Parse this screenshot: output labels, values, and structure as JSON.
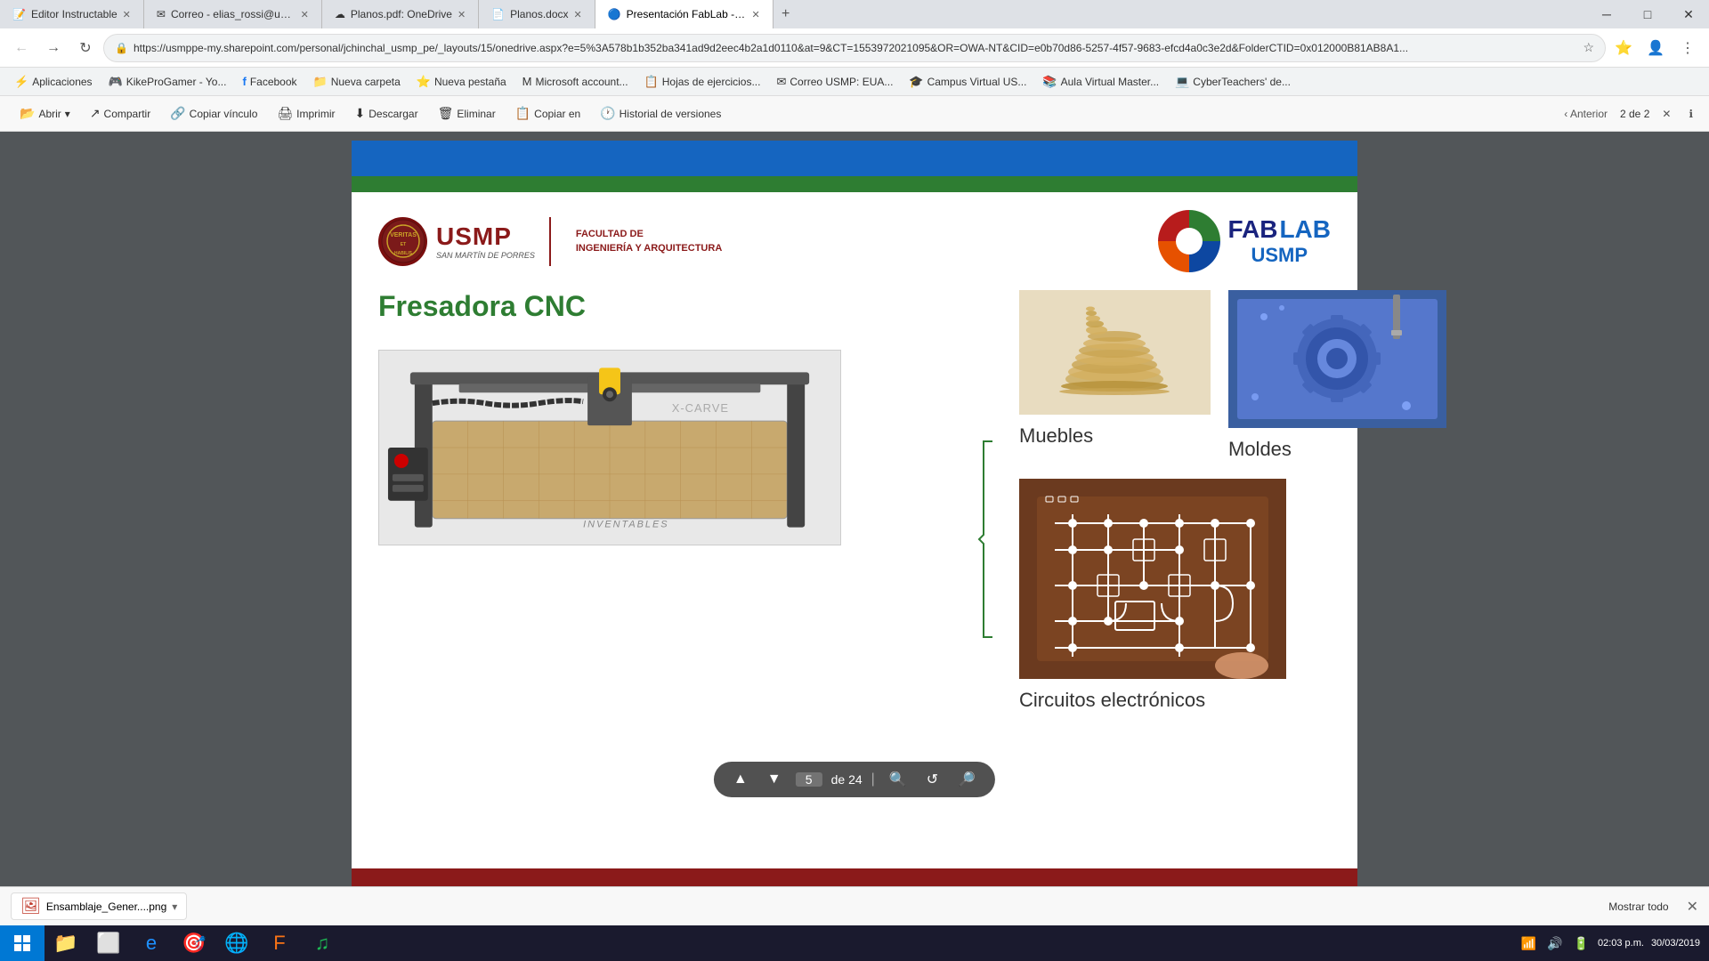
{
  "tabs": [
    {
      "id": "tab1",
      "title": "Editor Instructable",
      "favicon": "📝",
      "active": false
    },
    {
      "id": "tab2",
      "title": "Correo - elias_rossi@usmp.pe",
      "favicon": "✉",
      "active": false
    },
    {
      "id": "tab3",
      "title": "Planos.pdf: OneDrive",
      "favicon": "☁",
      "active": false
    },
    {
      "id": "tab4",
      "title": "Planos.docx",
      "favicon": "📄",
      "active": false
    },
    {
      "id": "tab5",
      "title": "Presentación FabLab - Actividad:",
      "favicon": "🔵",
      "active": true
    }
  ],
  "address_bar": {
    "url": "https://usmppe-my.sharepoint.com/personal/jchinchal_usmp_pe/_layouts/15/onedrive.aspx?e=5%3A578b1b352ba341ad9d2eec4b2a1d0110&at=9&CT=1553972021095&OR=OWA-NT&CID=e0b70d86-5257-4f57-9683-efcd4a0c3e2d&FolderCTID=0x012000B81AB8A1..."
  },
  "bookmarks": [
    {
      "label": "Aplicaciones",
      "icon": "⚡"
    },
    {
      "label": "KikeProGamer - Yo...",
      "icon": "🎮"
    },
    {
      "label": "Facebook",
      "icon": "f"
    },
    {
      "label": "Nueva carpeta",
      "icon": "📁"
    },
    {
      "label": "Nueva pestaña",
      "icon": "⭐"
    },
    {
      "label": "Microsoft account...",
      "icon": "M"
    },
    {
      "label": "Hojas de ejercicios...",
      "icon": "📋"
    },
    {
      "label": "Correo USMP: EUA...",
      "icon": "✉"
    },
    {
      "label": "Campus Virtual US...",
      "icon": "🎓"
    },
    {
      "label": "Aula Virtual Master...",
      "icon": "📚"
    },
    {
      "label": "CyberTeachers' de...",
      "icon": "💻"
    }
  ],
  "toolbar": {
    "open_label": "Abrir",
    "share_label": "Compartir",
    "copy_link_label": "Copiar vínculo",
    "print_label": "Imprimir",
    "download_label": "Descargar",
    "delete_label": "Eliminar",
    "copy_to_label": "Copiar en",
    "version_history_label": "Historial de versiones",
    "prev_label": "Anterior",
    "page_counter": "2 de 2"
  },
  "slide": {
    "title": "Fresadora CNC",
    "usmp": {
      "university": "USMP",
      "faculty_line1": "FACULTAD DE",
      "faculty_line2": "INGENIERÍA Y ARQUITECTURA",
      "full_name": "SAN MARTÍN DE PORRES"
    },
    "fablab": {
      "fab": "FAB",
      "lab": "LAB",
      "usmp": "USMP"
    },
    "images": {
      "muebles_label": "Muebles",
      "moldes_label": "Moldes",
      "circuitos_label": "Circuitos electrónicos"
    }
  },
  "pdf_nav": {
    "current_page": "5",
    "total_label": "de 24"
  },
  "download_bar": {
    "filename": "Ensamblaje_Gener....png",
    "show_all_label": "Mostrar todo"
  },
  "window_controls": {
    "minimize": "─",
    "maximize": "□",
    "close": "✕"
  },
  "taskbar": {
    "time": "02:03 p.m.",
    "date": "30/03/2019"
  }
}
